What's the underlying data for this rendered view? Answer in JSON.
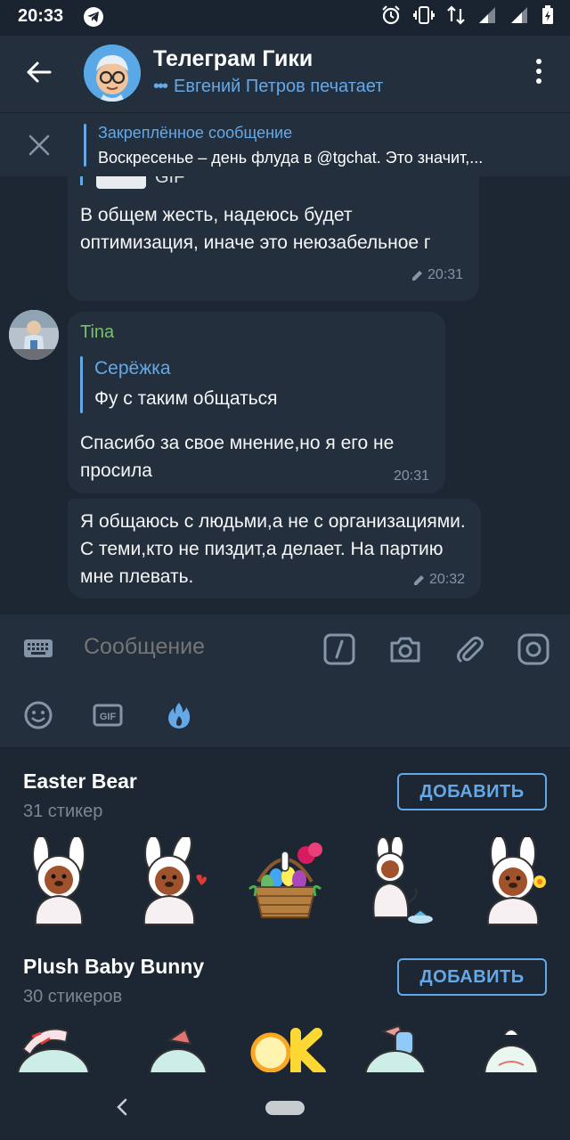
{
  "status_bar": {
    "time": "20:33"
  },
  "header": {
    "title": "Телеграм Гики",
    "status": "Евгений Петров печатает",
    "typing_dots": "•••"
  },
  "pinned": {
    "title": "Закреплённое сообщение",
    "text": "Воскресенье – день флуда в @tgchat.  Это значит,..."
  },
  "messages": [
    {
      "id": "m1",
      "media_label": "GIF",
      "text": "В общем жесть, надеюсь будет оптимизация, иначе это неюзабельное г",
      "time": "20:31",
      "edited": true
    },
    {
      "id": "m2",
      "sender": "Tina",
      "reply_to": {
        "name": "Серёжка",
        "text": "Фу с таким общаться"
      },
      "text": "Спасибо за свое мнение,но я его не просила",
      "time": "20:31",
      "edited": false
    },
    {
      "id": "m3",
      "text": "Я общаюсь с людьми,а не с организациями. С теми,кто не пиздит,а делает. На партию мне плевать.",
      "time": "20:32",
      "edited": true
    }
  ],
  "composer": {
    "placeholder": "Сообщение"
  },
  "sticker_sets": [
    {
      "title": "Easter Bear",
      "count": "31 стикер",
      "add_label": "ДОБАВИТЬ"
    },
    {
      "title": "Plush Baby Bunny",
      "count": "30 стикеров",
      "add_label": "ДОБАВИТЬ"
    }
  ],
  "colors": {
    "accent": "#64a8e8",
    "header_bg": "#242f3d",
    "chat_bg": "#1d2733",
    "sender_green": "#7ac06a",
    "meta_gray": "#8395a7",
    "active_tab": "#64a8e8"
  }
}
